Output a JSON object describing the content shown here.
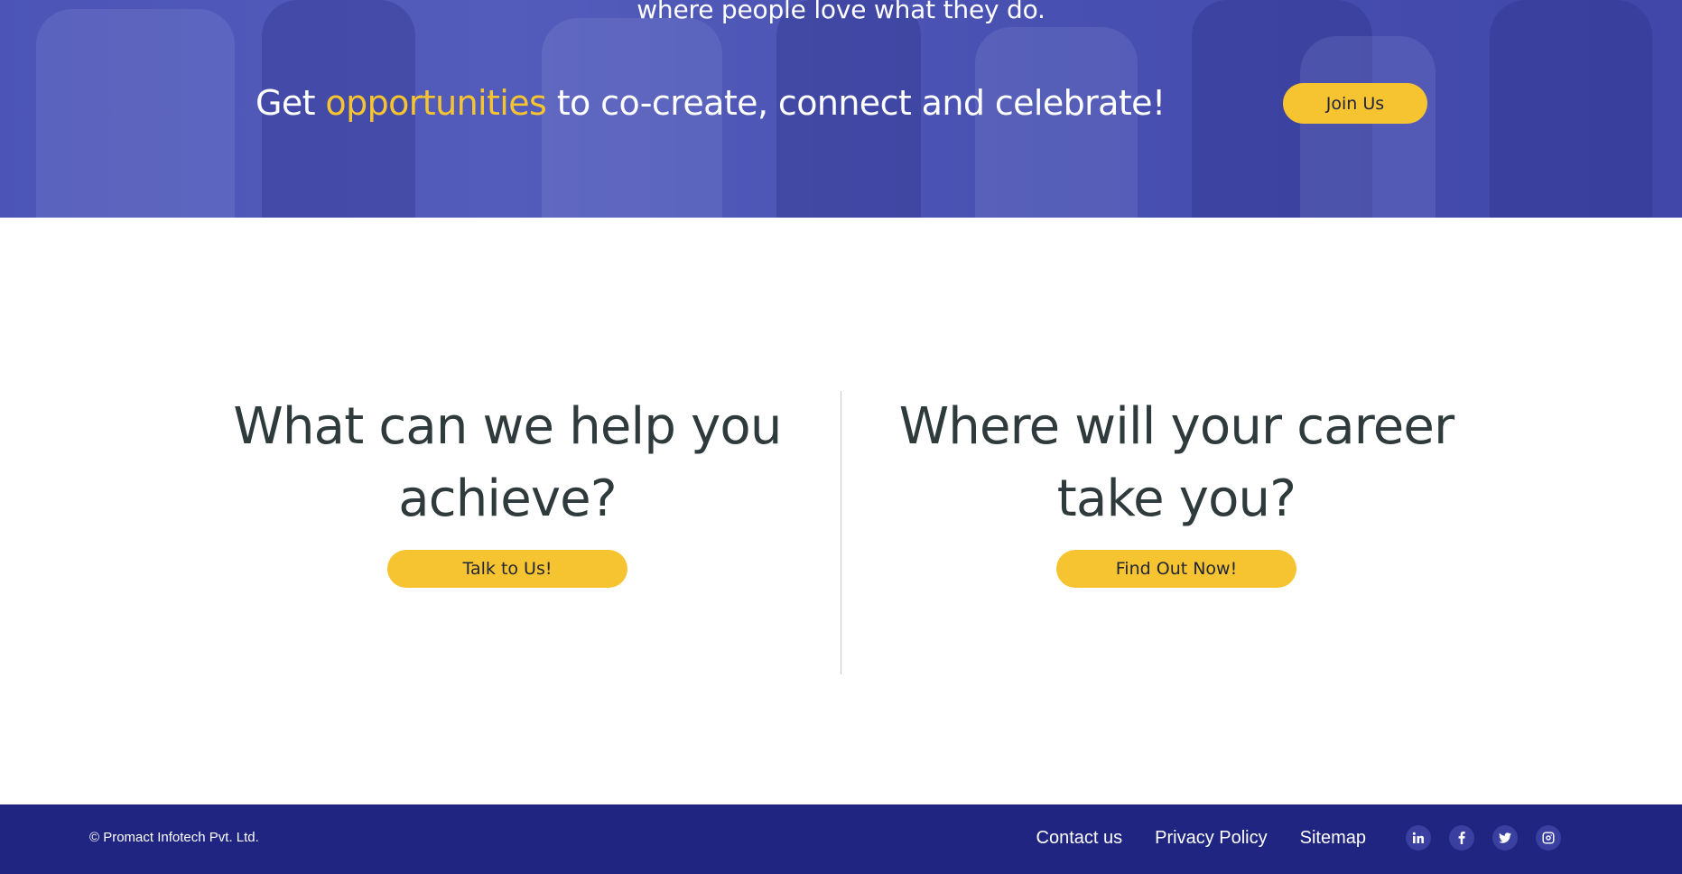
{
  "hero": {
    "tagline": "where people love what they do.",
    "cta_prefix": "Get",
    "cta_accent": "opportunities",
    "cta_suffix": "to co-create, connect and celebrate!",
    "join_label": "Join Us"
  },
  "sections": {
    "left": {
      "heading_line1": "What can we help you",
      "heading_line2": "achieve?",
      "button_label": "Talk to Us!"
    },
    "right": {
      "heading_line1": "Where will your career",
      "heading_line2": "take you?",
      "button_label": "Find Out Now!"
    }
  },
  "footer": {
    "copyright": "© Promact Infotech Pvt. Ltd.",
    "links": [
      "Contact us",
      "Privacy Policy",
      "Sitemap"
    ],
    "social_icons": [
      "linkedin-icon",
      "facebook-icon",
      "twitter-icon",
      "instagram-icon"
    ]
  },
  "colors": {
    "accent": "#f7c431",
    "hero_blue": "#4f58b8",
    "footer_blue": "#1f2580",
    "heading_text": "#2f3a3c"
  }
}
